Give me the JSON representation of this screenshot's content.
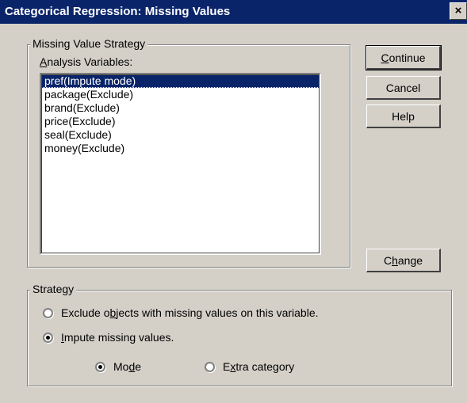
{
  "window": {
    "title": "Categorical Regression: Missing Values",
    "close_symbol": "×"
  },
  "strategy_group": {
    "label": "Missing Value Strategy",
    "analysis_label": {
      "pre": "",
      "key": "A",
      "post": "nalysis Variables:"
    },
    "variables": [
      {
        "text": "pref(Impute mode)",
        "selected": true
      },
      {
        "text": "package(Exclude)",
        "selected": false
      },
      {
        "text": "brand(Exclude)",
        "selected": false
      },
      {
        "text": "price(Exclude)",
        "selected": false
      },
      {
        "text": "seal(Exclude)",
        "selected": false
      },
      {
        "text": "money(Exclude)",
        "selected": false
      }
    ]
  },
  "buttons": {
    "continue": {
      "pre": "",
      "key": "C",
      "post": "ontinue"
    },
    "cancel": "Cancel",
    "help": "Help",
    "change": {
      "pre": "C",
      "key": "h",
      "post": "ange"
    }
  },
  "strategy": {
    "label": {
      "pre": "Strate",
      "key": "g",
      "post": "y"
    },
    "exclude": {
      "pre": "Exclude o",
      "key": "b",
      "post": "jects with missing values on this variable.",
      "checked": false
    },
    "impute": {
      "pre": "",
      "key": "I",
      "post": "mpute missing values.",
      "checked": true
    },
    "mode": {
      "pre": "Mo",
      "key": "d",
      "post": "e",
      "checked": true
    },
    "extra": {
      "pre": "E",
      "key": "x",
      "post": "tra category",
      "checked": false
    }
  }
}
